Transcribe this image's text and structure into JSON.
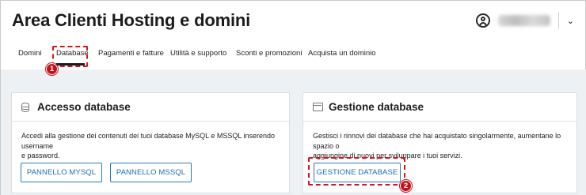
{
  "header": {
    "title": "Area Clienti Hosting e domini",
    "user_icon": "user-circle-icon",
    "dropdown_icon": "chevron-down-icon"
  },
  "tabs": [
    {
      "label": "Domini",
      "active": false
    },
    {
      "label": "Database",
      "active": true
    },
    {
      "label": "Pagamenti e fatture",
      "active": false
    },
    {
      "label": "Utilità e supporto",
      "active": false
    },
    {
      "label": "Sconti e promozioni",
      "active": false
    },
    {
      "label": "Acquista un dominio",
      "active": false
    }
  ],
  "cards": {
    "access": {
      "icon": "database-icon",
      "title": "Accesso database",
      "text_line1": "Accedi alla gestione dei contenuti dei tuoi database MySQL e MSSQL inserendo username",
      "text_line2": "e password.",
      "btn_mysql": "PANNELLO MYSQL",
      "btn_mssql": "PANNELLO MSSQL"
    },
    "manage": {
      "icon": "window-icon",
      "title": "Gestione database",
      "text_line1": "Gestisci i rinnovi dei database che hai acquistato singolarmente, aumentane lo spazio o",
      "text_line2": "aggiungine di nuovi per sviluppare i tuoi servizi.",
      "btn_manage": "GESTIONE DATABASE"
    }
  },
  "annotations": {
    "marker1": "1",
    "marker2": "2",
    "color": "#c4121b"
  },
  "colors": {
    "accent": "#1e6fb3",
    "background": "#eef1f4"
  }
}
